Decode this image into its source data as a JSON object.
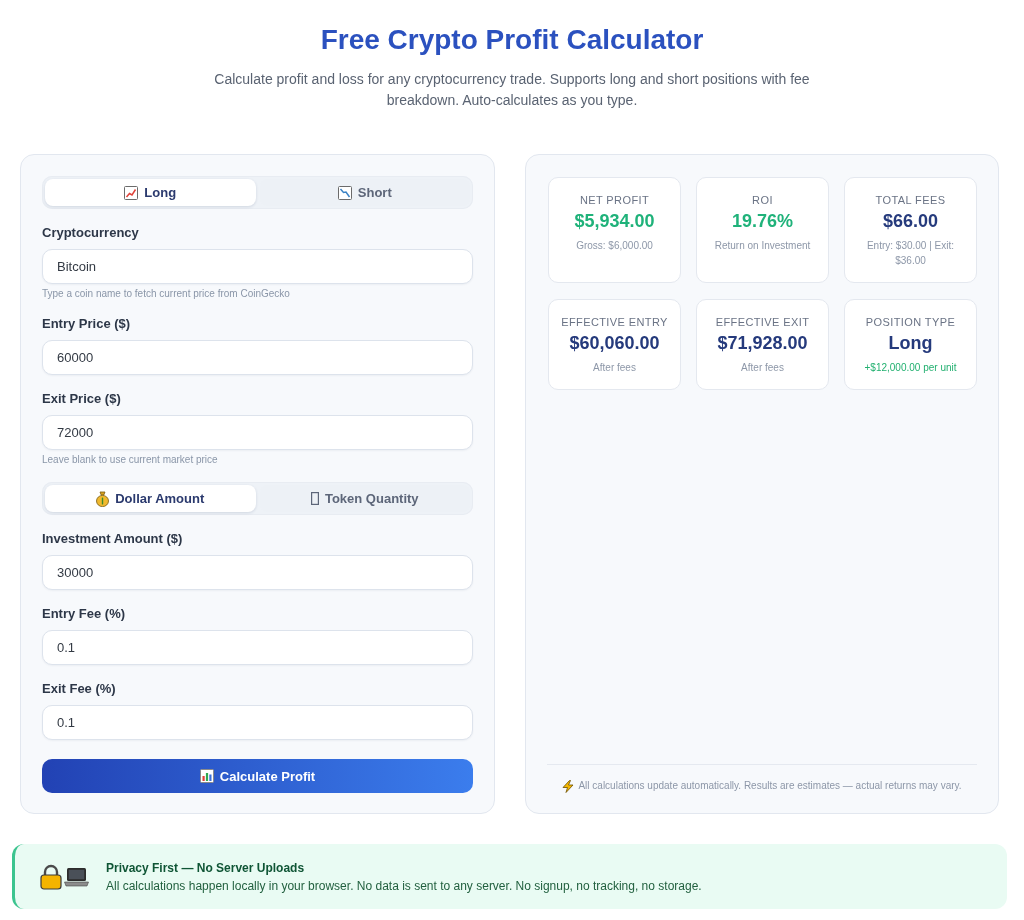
{
  "header": {
    "title": "Free Crypto Profit Calculator",
    "subtitle": "Calculate profit and loss for any cryptocurrency trade. Supports long and short positions with fee breakdown. Auto-calculates as you type."
  },
  "calculator": {
    "position_tabs": [
      {
        "kind": "long",
        "label": "Long",
        "selected": true
      },
      {
        "kind": "short",
        "label": "Short",
        "selected": false
      }
    ],
    "price_fields": [
      {
        "label": "Cryptocurrency",
        "value": "Bitcoin",
        "hint": "Type a coin name to fetch current price from CoinGecko"
      },
      {
        "label": "Entry Price ($)",
        "value": "60000"
      },
      {
        "label": "Exit Price ($)",
        "value": "72000",
        "hint": "Leave blank to use current market price"
      }
    ],
    "amount_tabs": [
      {
        "kind": "dollar",
        "label": "Dollar Amount",
        "selected": true
      },
      {
        "kind": "token",
        "label": "Token Quantity",
        "selected": false
      }
    ],
    "amount_fields": [
      {
        "label": "Investment Amount ($)",
        "value": "30000"
      },
      {
        "label": "Entry Fee (%)",
        "value": "0.1"
      },
      {
        "label": "Exit Fee (%)",
        "value": "0.1"
      }
    ],
    "calculate_button": "Calculate Profit"
  },
  "results": {
    "cards": [
      {
        "label": "NET PROFIT",
        "value": "$5,934.00",
        "value_positive": true,
        "note": "Gross: $6,000.00",
        "note_positive": false
      },
      {
        "label": "ROI",
        "value": "19.76%",
        "value_positive": true,
        "note": "Return on Investment",
        "note_positive": false
      },
      {
        "label": "TOTAL FEES",
        "value": "$66.00",
        "value_positive": false,
        "note": "Entry: $30.00 | Exit: $36.00",
        "note_positive": false
      },
      {
        "label": "EFFECTIVE ENTRY",
        "value": "$60,060.00",
        "value_positive": false,
        "note": "After fees",
        "note_positive": false
      },
      {
        "label": "EFFECTIVE EXIT",
        "value": "$71,928.00",
        "value_positive": false,
        "note": "After fees",
        "note_positive": false
      },
      {
        "label": "POSITION TYPE",
        "value": "Long",
        "value_positive": false,
        "note": "+$12,000.00 per unit",
        "note_positive": true
      }
    ],
    "note": "All calculations update automatically. Results are estimates — actual returns may vary."
  },
  "privacy": {
    "title": "Privacy First — No Server Uploads",
    "text": "All calculations happen locally in your browser. No data is sent to any server. No signup, no tracking, no storage."
  }
}
